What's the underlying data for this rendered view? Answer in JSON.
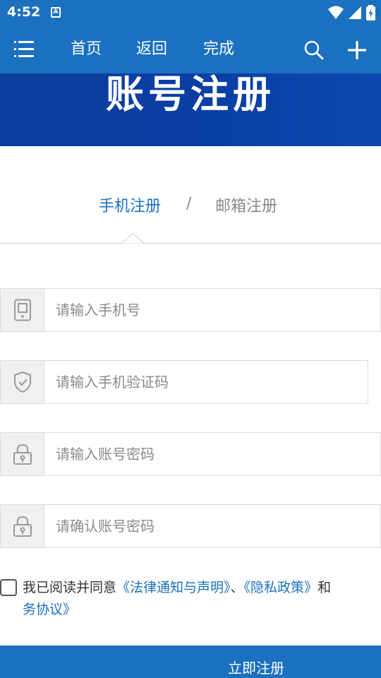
{
  "status_bar": {
    "time": "4:52",
    "notification_icon": "a-box-icon",
    "icons": [
      "wifi-icon",
      "signal-icon",
      "battery-charging-icon"
    ]
  },
  "nav": {
    "menu_icon": "menu-icon",
    "home": "首页",
    "back": "返回",
    "done": "完成",
    "search_icon": "search-icon",
    "add_icon": "plus-icon"
  },
  "banner": {
    "title": "账号注册"
  },
  "tabs": {
    "phone": "手机注册",
    "separator": "/",
    "email": "邮箱注册",
    "active": "phone"
  },
  "form": {
    "phone": {
      "placeholder": "请输入手机号",
      "value": "",
      "icon": "phone-icon"
    },
    "code": {
      "placeholder": "请输入手机验证码",
      "value": "",
      "icon": "shield-icon"
    },
    "password": {
      "placeholder": "请输入账号密码",
      "value": "",
      "icon": "lock-icon"
    },
    "confirm": {
      "placeholder": "请确认账号密码",
      "value": "",
      "icon": "lock-icon"
    }
  },
  "agreement": {
    "prefix": "我已阅读并同意",
    "legal_link": "《法律通知与声明》",
    "separator": "、",
    "privacy_link": "《隐私政策》",
    "conjunction": "和",
    "line2_text": "务协议》",
    "checked": false
  },
  "submit": {
    "label": "立即注册"
  },
  "colors": {
    "primary": "#1b70bf",
    "banner": "#0a3ea3",
    "placeholder": "#8a8a8a"
  }
}
